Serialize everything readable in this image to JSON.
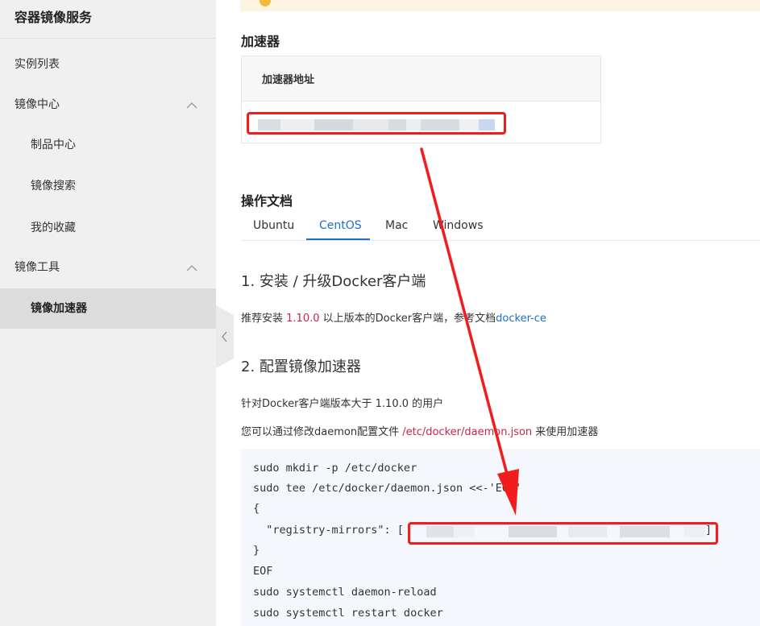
{
  "sidebar": {
    "title": "容器镜像服务",
    "items": [
      {
        "label": "实例列表"
      },
      {
        "label": "镜像中心"
      },
      {
        "label": "制品中心"
      },
      {
        "label": "镜像搜索"
      },
      {
        "label": "我的收藏"
      },
      {
        "label": "镜像工具"
      },
      {
        "label": "镜像加速器"
      }
    ]
  },
  "accelerator": {
    "heading": "加速器",
    "column_header": "加速器地址"
  },
  "docs": {
    "heading": "操作文档",
    "tabs": [
      {
        "label": "Ubuntu"
      },
      {
        "label": "CentOS"
      },
      {
        "label": "Mac"
      },
      {
        "label": "Windows"
      }
    ],
    "active_tab": "CentOS",
    "step1": {
      "title": "1. 安装 / 升级Docker客户端",
      "text_before": "推荐安装 ",
      "version": "1.10.0",
      "text_after": " 以上版本的Docker客户端，参考文档",
      "link": "docker-ce"
    },
    "step2": {
      "title": "2. 配置镜像加速器",
      "line1": "针对Docker客户端版本大于 1.10.0 的用户",
      "line2_before": "您可以通过修改daemon配置文件 ",
      "line2_path": "/etc/docker/daemon.json",
      "line2_after": " 来使用加速器"
    },
    "code_lines": [
      "sudo mkdir -p /etc/docker",
      "sudo tee /etc/docker/daemon.json <<-'EOF'",
      "{",
      "  \"registry-mirrors\": [",
      "}",
      "EOF",
      "sudo systemctl daemon-reload",
      "sudo systemctl restart docker"
    ],
    "code_close_bracket": "]"
  },
  "colors": {
    "accent": "#1f6fc4",
    "highlight_red": "#f21c1c",
    "link_red": "#c7254e"
  }
}
